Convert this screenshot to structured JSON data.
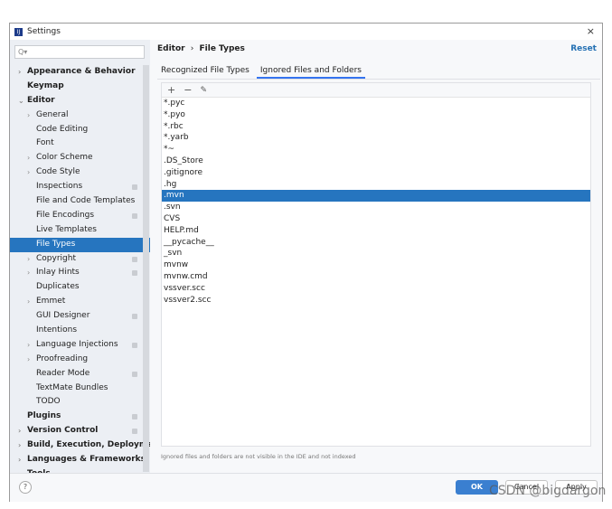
{
  "window": {
    "title": "Settings",
    "close": "×"
  },
  "search": {
    "placeholder": "Q▾"
  },
  "sidebar": {
    "items": [
      {
        "label": "Appearance & Behavior",
        "level": 0,
        "bold": true,
        "chevron": ">"
      },
      {
        "label": "Keymap",
        "level": 0,
        "bold": true,
        "chevron": ""
      },
      {
        "label": "Editor",
        "level": 0,
        "bold": true,
        "chevron": "v"
      },
      {
        "label": "General",
        "level": 1,
        "chevron": ">"
      },
      {
        "label": "Code Editing",
        "level": 1,
        "chevron": ""
      },
      {
        "label": "Font",
        "level": 1,
        "chevron": ""
      },
      {
        "label": "Color Scheme",
        "level": 1,
        "chevron": ">"
      },
      {
        "label": "Code Style",
        "level": 1,
        "chevron": ">"
      },
      {
        "label": "Inspections",
        "level": 1,
        "chevron": "",
        "badge": true
      },
      {
        "label": "File and Code Templates",
        "level": 1,
        "chevron": ""
      },
      {
        "label": "File Encodings",
        "level": 1,
        "chevron": "",
        "badge": true
      },
      {
        "label": "Live Templates",
        "level": 1,
        "chevron": ""
      },
      {
        "label": "File Types",
        "level": 1,
        "chevron": "",
        "selected": true
      },
      {
        "label": "Copyright",
        "level": 1,
        "chevron": ">",
        "badge": true
      },
      {
        "label": "Inlay Hints",
        "level": 1,
        "chevron": ">",
        "badge": true
      },
      {
        "label": "Duplicates",
        "level": 1,
        "chevron": ""
      },
      {
        "label": "Emmet",
        "level": 1,
        "chevron": ">"
      },
      {
        "label": "GUI Designer",
        "level": 1,
        "chevron": "",
        "badge": true
      },
      {
        "label": "Intentions",
        "level": 1,
        "chevron": ""
      },
      {
        "label": "Language Injections",
        "level": 1,
        "chevron": ">",
        "badge": true
      },
      {
        "label": "Proofreading",
        "level": 1,
        "chevron": ">"
      },
      {
        "label": "Reader Mode",
        "level": 1,
        "chevron": "",
        "badge": true
      },
      {
        "label": "TextMate Bundles",
        "level": 1,
        "chevron": ""
      },
      {
        "label": "TODO",
        "level": 1,
        "chevron": ""
      },
      {
        "label": "Plugins",
        "level": 0,
        "bold": true,
        "chevron": "",
        "badge": true
      },
      {
        "label": "Version Control",
        "level": 0,
        "bold": true,
        "chevron": ">",
        "badge": true
      },
      {
        "label": "Build, Execution, Deployment",
        "level": 0,
        "bold": true,
        "chevron": ">"
      },
      {
        "label": "Languages & Frameworks",
        "level": 0,
        "bold": true,
        "chevron": ">"
      },
      {
        "label": "Tools",
        "level": 0,
        "bold": true,
        "chevron": ">"
      }
    ]
  },
  "main": {
    "breadcrumb": {
      "parent": "Editor",
      "separator": "›",
      "current": "File Types"
    },
    "reset": "Reset",
    "tabs": [
      {
        "label": "Recognized File Types",
        "active": false
      },
      {
        "label": "Ignored Files and Folders",
        "active": true
      }
    ],
    "toolbar": {
      "add": "+",
      "remove": "−",
      "edit": "✎"
    },
    "files": [
      "*.pyc",
      "*.pyo",
      "*.rbc",
      "*.yarb",
      "*~",
      ".DS_Store",
      ".gitignore",
      ".hg",
      ".mvn",
      ".svn",
      "CVS",
      "HELP.md",
      "__pycache__",
      "_svn",
      "mvnw",
      "mvnw.cmd",
      "vssver.scc",
      "vssver2.scc"
    ],
    "selected_file": ".mvn",
    "hint": "Ignored files and folders are not visible in the IDE and not indexed"
  },
  "footer": {
    "help": "?",
    "ok": "OK",
    "cancel": "Cancel",
    "apply": "Apply"
  },
  "watermark": "CSDN @bigdargon",
  "colors": {
    "selection": "#2675bf",
    "accent": "#3574f0",
    "link": "#2470b3"
  }
}
